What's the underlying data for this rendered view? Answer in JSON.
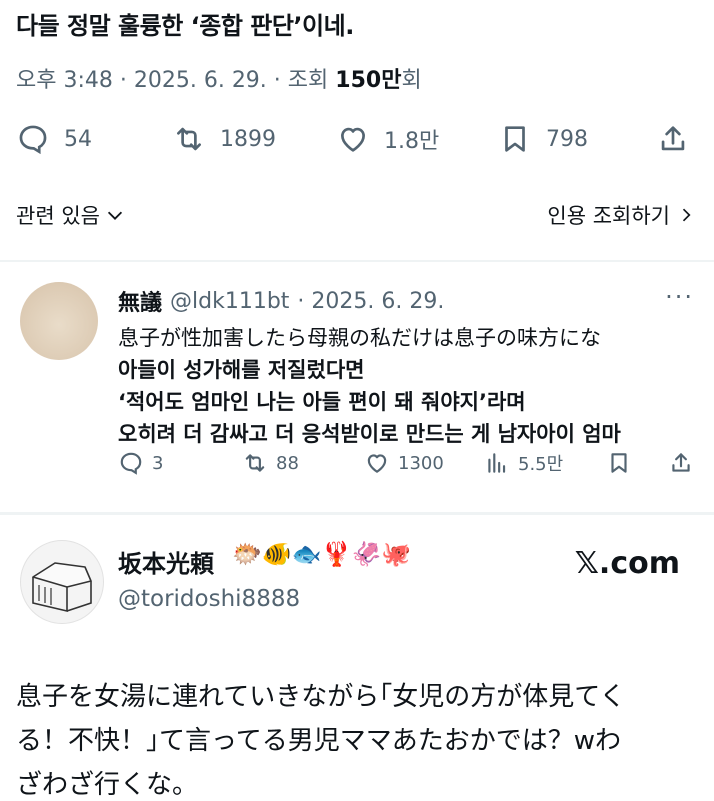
{
  "post": {
    "text": "다들 정말 훌륭한 ‘종합 판단’이네.",
    "meta_prefix": "오후 3:48 · 2025. 6. 29. · 조회 ",
    "views": "150만",
    "views_suffix": "회"
  },
  "actions": {
    "replies": "54",
    "reposts": "1899",
    "likes": "1.8만",
    "bookmarks": "798"
  },
  "related": {
    "label": "관련 있음",
    "quotes_label": "인용 조회하기"
  },
  "reply": {
    "name": "無議",
    "handle": "@ldk111bt",
    "date": "· 2025. 6. 29.",
    "lines": [
      "息子が性加害したら母親の私だけは息子の味方にな",
      "아들이 성가해를 저질렀다면",
      "‘적어도 엄마인 나는 아들 편이 돼 줘야지’라며",
      "오히려 더 감싸고 더 응석받이로 만드는 게 남자아이 엄마"
    ],
    "actions": {
      "replies": "3",
      "reposts": "88",
      "likes": "1300",
      "views": "5.5만"
    }
  },
  "tweet": {
    "name": "坂本光頼",
    "emojis": "🐡🐠🐟🦞🦑🐙",
    "handle": "@toridoshi8888",
    "brand": "𝕏.com",
    "lines": [
      "息子を女湯に連れていきながら｢女児の方が体見てく",
      "る！不快！｣て言ってる男児ママあたおかでは？wわ",
      "ざわざ行くな。"
    ]
  }
}
